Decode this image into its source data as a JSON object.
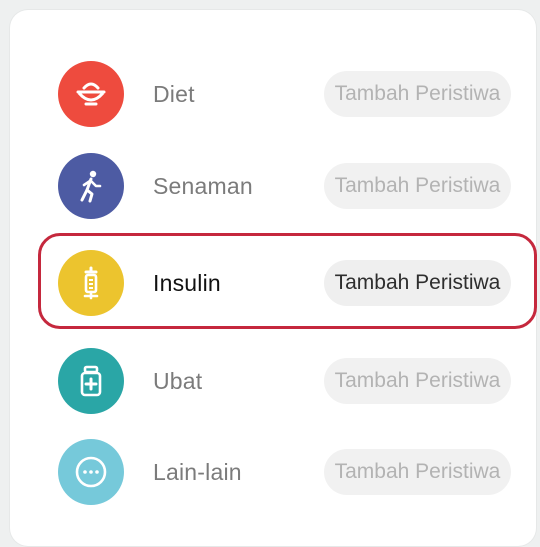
{
  "items": [
    {
      "label": "Diet",
      "button": "Tambah Peristiwa",
      "icon": "bowl-icon",
      "color": "#ee4b3e"
    },
    {
      "label": "Senaman",
      "button": "Tambah Peristiwa",
      "icon": "walking-person-icon",
      "color": "#4d5ba3"
    },
    {
      "label": "Insulin",
      "button": "Tambah Peristiwa",
      "icon": "syringe-icon",
      "color": "#ecc42e"
    },
    {
      "label": "Ubat",
      "button": "Tambah Peristiwa",
      "icon": "medicine-bottle-icon",
      "color": "#2aa6a6"
    },
    {
      "label": "Lain-lain",
      "button": "Tambah Peristiwa",
      "icon": "more-dots-icon",
      "color": "#76c9da"
    }
  ],
  "selected_item": "Insulin",
  "highlight_color": "#c5283d"
}
